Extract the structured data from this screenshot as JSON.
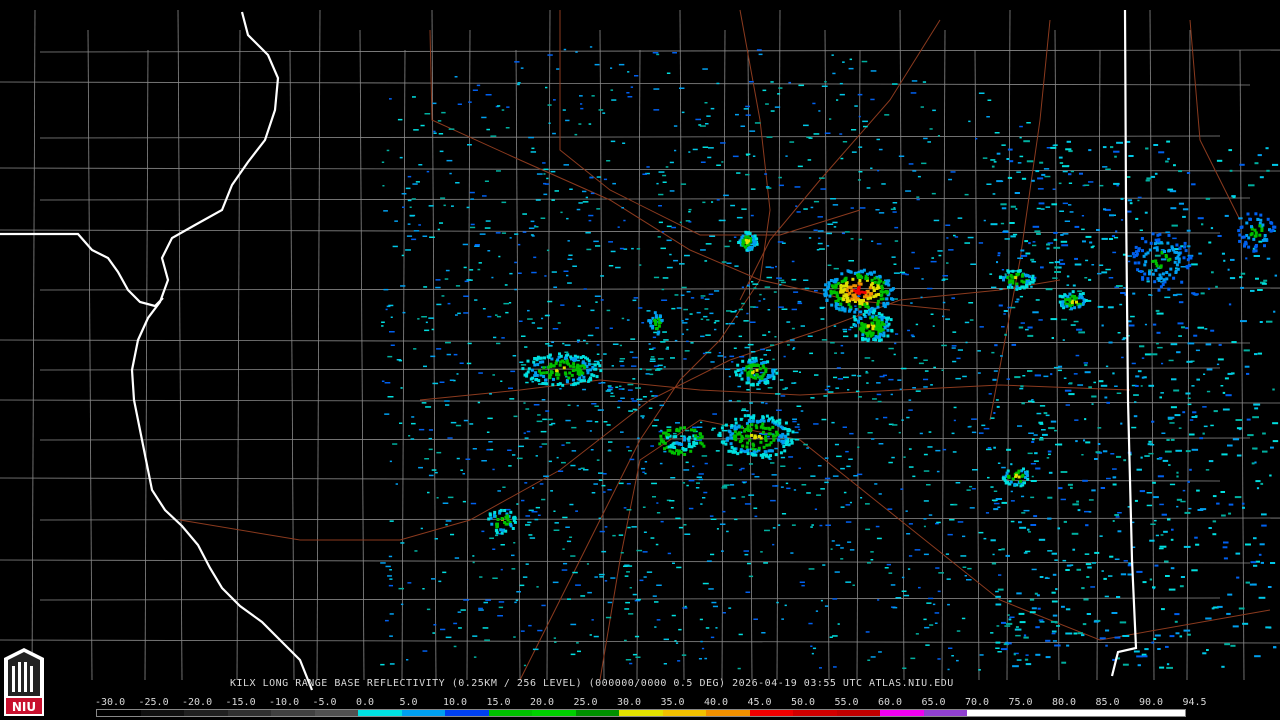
{
  "caption": "KILX LONG RANGE BASE REFLECTIVITY (0.25KM / 256 LEVEL) (000000/0000 0.5 DEG) 2026-04-19 03:55 UTC  ATLAS.NIU.EDU",
  "logo_text": "NIU",
  "scale": {
    "labels": [
      "-30.0",
      "-25.0",
      "-20.0",
      "-15.0",
      "-10.0",
      "-5.0",
      "0.0",
      "5.0",
      "10.0",
      "15.0",
      "20.0",
      "25.0",
      "30.0",
      "35.0",
      "40.0",
      "45.0",
      "50.0",
      "55.0",
      "60.0",
      "65.0",
      "70.0",
      "75.0",
      "80.0",
      "85.0",
      "90.0",
      "94.5"
    ],
    "colors": [
      "#000000",
      "#101010",
      "#202020",
      "#303030",
      "#404040",
      "#505050",
      "#00e0e0",
      "#00a0f0",
      "#0040f0",
      "#00c000",
      "#00d000",
      "#009000",
      "#e0e000",
      "#f0c000",
      "#f09000",
      "#f00000",
      "#d00000",
      "#c00000",
      "#f000f0",
      "#9040d0",
      "#ffffff",
      "#ffffff",
      "#ffffff",
      "#ffffff",
      "#ffffff"
    ]
  },
  "colors": {
    "background": "#000000",
    "county_lines": "#8a8a8a",
    "state_lines": "#ffffff",
    "highways": "#8b3a1e"
  }
}
